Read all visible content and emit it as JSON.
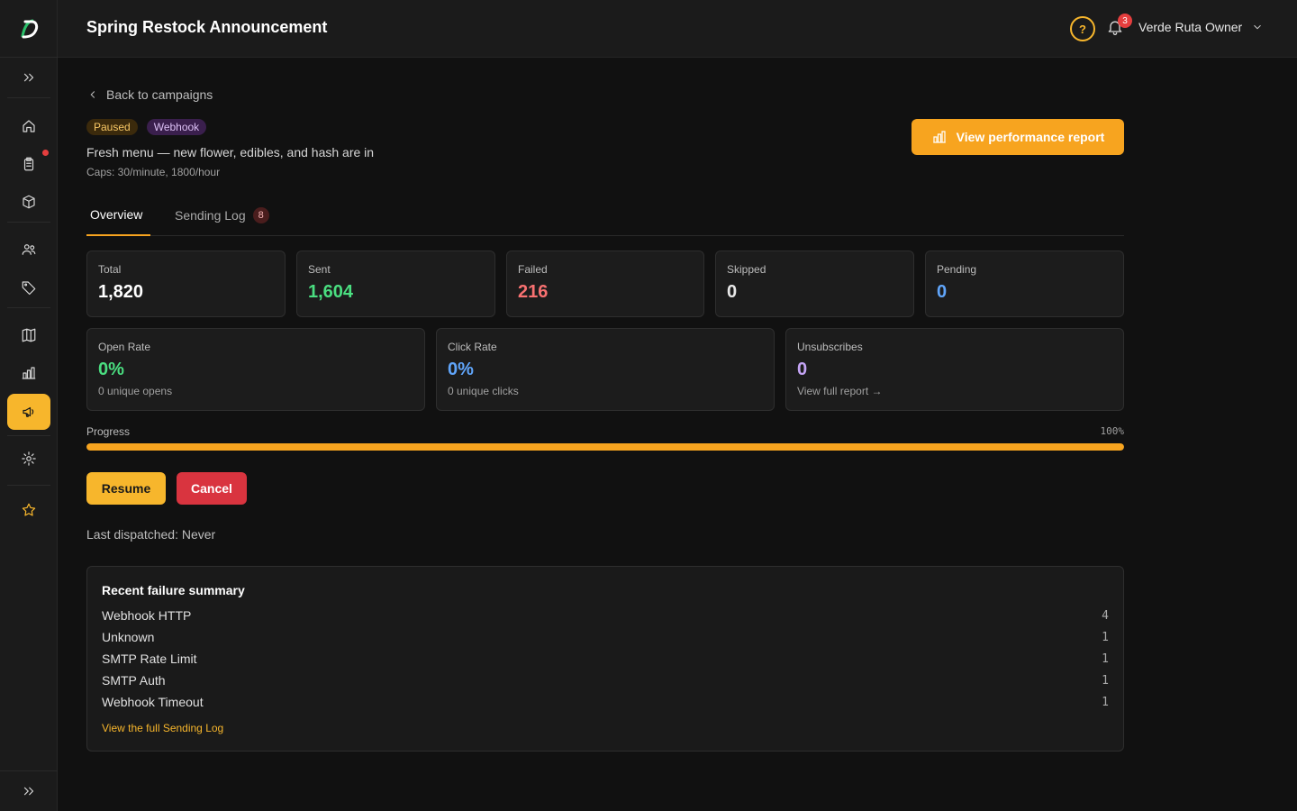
{
  "header": {
    "title": "Spring Restock Announcement",
    "help_icon": "?",
    "notification_count": "3",
    "user_name": "Verde Ruta Owner"
  },
  "campaign": {
    "back_label": "Back to campaigns",
    "status_badge": "Paused",
    "channel_badge": "Webhook",
    "subtitle": "Fresh menu — new flower, edibles, and hash are in",
    "caps": "Caps: 30/minute, 1800/hour",
    "report_button": "View performance report"
  },
  "tabs": [
    {
      "label": "Overview",
      "active": true
    },
    {
      "label": "Sending Log",
      "count": "8"
    }
  ],
  "stats": [
    {
      "label": "Total",
      "value": "1,820",
      "color": "#ffffff"
    },
    {
      "label": "Sent",
      "value": "1,604",
      "color": "#4ade80"
    },
    {
      "label": "Failed",
      "value": "216",
      "color": "#f87171"
    },
    {
      "label": "Skipped",
      "value": "0",
      "color": "#e8e8e8"
    },
    {
      "label": "Pending",
      "value": "0",
      "color": "#60a5fa"
    }
  ],
  "rates": [
    {
      "label": "Open Rate",
      "value": "0%",
      "sub": "0 unique opens",
      "color": "#4ade80"
    },
    {
      "label": "Click Rate",
      "value": "0%",
      "sub": "0 unique clicks",
      "color": "#60a5fa"
    },
    {
      "label": "Unsubscribes",
      "value": "0",
      "sub": "View full report →",
      "color": "#c4a4f5"
    }
  ],
  "progress": {
    "label": "Progress",
    "percent_label": "100%",
    "fraction": 1.0
  },
  "actions": {
    "resume": "Resume",
    "cancel": "Cancel"
  },
  "last_dispatched": {
    "label": "Last dispatched:",
    "value": "Never"
  },
  "failures": {
    "title": "Recent failure summary",
    "rows": [
      {
        "name": "Webhook HTTP",
        "count": "4"
      },
      {
        "name": "Unknown",
        "count": "1"
      },
      {
        "name": "SMTP Rate Limit",
        "count": "1"
      },
      {
        "name": "SMTP Auth",
        "count": "1"
      },
      {
        "name": "Webhook Timeout",
        "count": "1"
      }
    ],
    "link": "View the full Sending Log"
  },
  "colors": {
    "accent": "#f7a41f",
    "danger": "#d9343f"
  },
  "sidebar": {
    "icons": [
      "expand-icon",
      "home-icon",
      "orders-icon",
      "box-icon",
      "users-icon",
      "tag-icon",
      "book-icon",
      "chart-icon",
      "megaphone-icon",
      "gear-icon",
      "star-icon",
      "expand-icon"
    ]
  }
}
